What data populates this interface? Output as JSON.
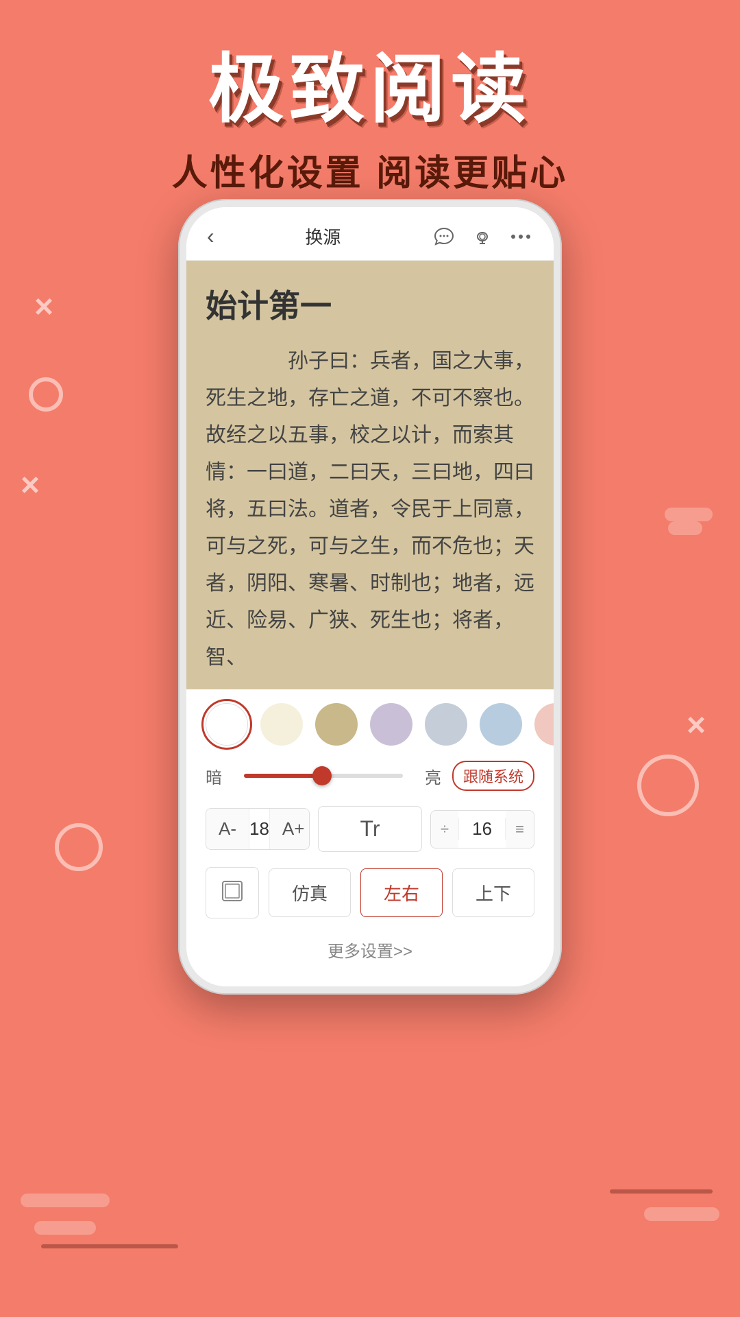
{
  "title": {
    "main": "极致阅读",
    "subtitle": "人性化设置  阅读更贴心"
  },
  "topbar": {
    "back": "‹",
    "center": "换源",
    "chat_icon": "💬",
    "audio_icon": "🎧",
    "more_icon": "···"
  },
  "reading": {
    "chapter": "始计第一",
    "text": "　　孙子曰：兵者，国之大事，死生之地，存亡之道，不可不察也。故经之以五事，校之以计，而索其情：一曰道，二曰天，三曰地，四曰将，五曰法。道者，令民于上同意，可与之死，可与之生，而不危也；天者，阴阳、寒暑、时制也；地者，远近、险易、广狭、死生也；将者，智、"
  },
  "settings": {
    "colors": [
      {
        "id": "white",
        "hex": "#FFFFFF",
        "active": true
      },
      {
        "id": "cream",
        "hex": "#F5F0DC",
        "active": false
      },
      {
        "id": "tan",
        "hex": "#C8B88A",
        "active": false
      },
      {
        "id": "lavender",
        "hex": "#C9C0D8",
        "active": false
      },
      {
        "id": "lightblue",
        "hex": "#C5CDD8",
        "active": false
      },
      {
        "id": "skyblue",
        "hex": "#B8CCE0",
        "active": false
      },
      {
        "id": "pink",
        "hex": "#F0C8C0",
        "active": false
      }
    ],
    "brightness": {
      "dark_label": "暗",
      "light_label": "亮",
      "system_label": "跟随系统",
      "value": 45
    },
    "font": {
      "decrease": "A-",
      "size": "18",
      "increase": "A+",
      "tt_label": "Tr",
      "line_up": "≑",
      "line_value": "16",
      "line_down": "≐"
    },
    "modes": [
      {
        "id": "icon",
        "label": "⊡",
        "active": false
      },
      {
        "id": "simulated",
        "label": "仿真",
        "active": false
      },
      {
        "id": "horizontal",
        "label": "左右",
        "active": true
      },
      {
        "id": "vertical",
        "label": "上下",
        "active": false
      }
    ],
    "more": "更多设置>>"
  }
}
